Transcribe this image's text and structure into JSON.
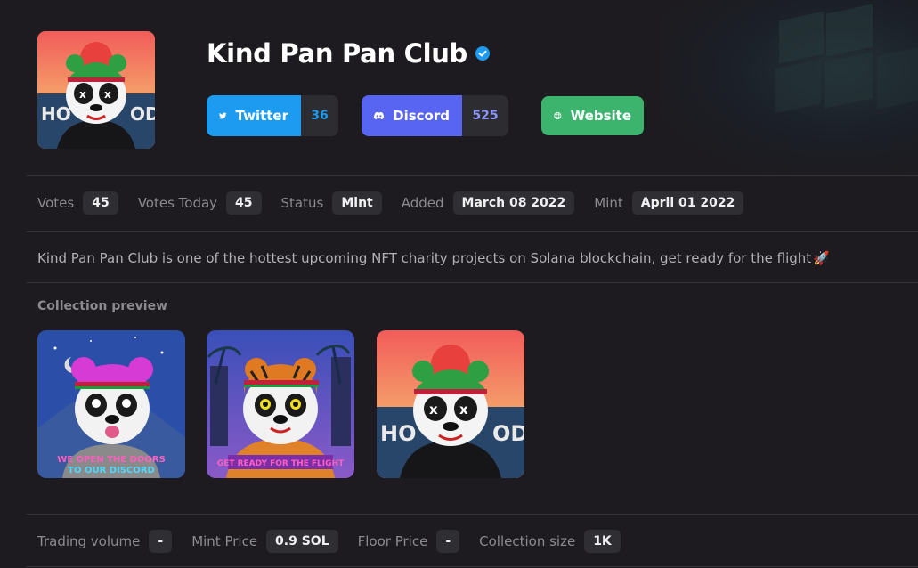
{
  "project": {
    "name": "Kind Pan Pan Club",
    "verified": true,
    "description": "Kind Pan Pan Club is one of the hottest upcoming NFT charity projects on Solana blockchain, get ready for the flight",
    "description_emoji": "🚀"
  },
  "socials": {
    "twitter": {
      "label": "Twitter",
      "count": "36",
      "icon": "twitter-bird-icon",
      "color": "#1d9bf0"
    },
    "discord": {
      "label": "Discord",
      "count": "525",
      "icon": "discord-icon",
      "color": "#5865f2"
    },
    "website": {
      "label": "Website",
      "icon": "globe-icon",
      "color": "#3cb46e"
    }
  },
  "stats": [
    {
      "label": "Votes",
      "value": "45"
    },
    {
      "label": "Votes Today",
      "value": "45"
    },
    {
      "label": "Status",
      "value": "Mint"
    },
    {
      "label": "Added",
      "value": "March 08 2022"
    },
    {
      "label": "Mint",
      "value": "April 01 2022"
    }
  ],
  "collection_preview": {
    "title": "Collection preview",
    "items": [
      {
        "caption_line1": "WE OPEN THE DOORS",
        "caption_line2": "TO OUR DISCORD"
      },
      {
        "caption_line1": "GET READY FOR THE FLIGHT",
        "caption_line2": ""
      },
      {
        "caption_line1": "",
        "caption_line2": ""
      }
    ]
  },
  "market": [
    {
      "label": "Trading volume",
      "value": "-"
    },
    {
      "label": "Mint Price",
      "value": "0.9 SOL"
    },
    {
      "label": "Floor Price",
      "value": "-"
    },
    {
      "label": "Collection size",
      "value": "1K"
    }
  ]
}
